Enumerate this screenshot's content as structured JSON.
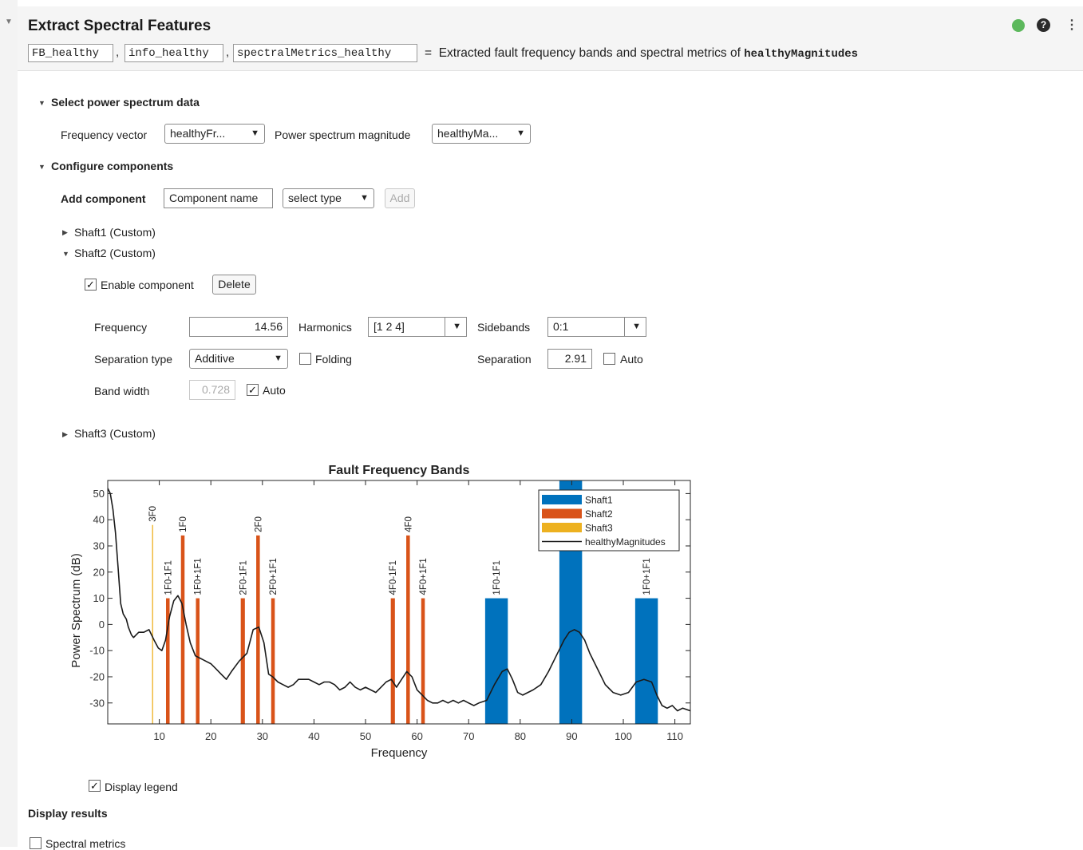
{
  "header": {
    "title": "Extract Spectral Features",
    "outputs": [
      "FB_healthy",
      "info_healthy",
      "spectralMetrics_healthy"
    ],
    "equals": "=",
    "description": "Extracted fault frequency bands and spectral metrics of",
    "description_var": "healthyMagnitudes",
    "status_color": "#5cb85c"
  },
  "power_section": {
    "title": "Select power spectrum data",
    "freq_label": "Frequency vector",
    "freq_value": "healthyFr...",
    "mag_label": "Power spectrum magnitude",
    "mag_value": "healthyMa..."
  },
  "components_section": {
    "title": "Configure components",
    "add_label": "Add component",
    "name_placeholder": "Component name",
    "type_value": "select type",
    "add_button": "Add",
    "shaft1": "Shaft1 (Custom)",
    "shaft2": "Shaft2 (Custom)",
    "shaft3": "Shaft3 (Custom)"
  },
  "shaft2": {
    "enable_label": "Enable component",
    "enabled": true,
    "delete_button": "Delete",
    "frequency_label": "Frequency",
    "frequency_value": "14.56",
    "harmonics_label": "Harmonics",
    "harmonics_value": "[1 2 4]",
    "sidebands_label": "Sidebands",
    "sidebands_value": "0:1",
    "separation_type_label": "Separation type",
    "separation_type_value": "Additive",
    "folding_label": "Folding",
    "folding": false,
    "separation_label": "Separation",
    "separation_value": "2.91",
    "separation_auto_label": "Auto",
    "separation_auto": false,
    "bandwidth_label": "Band width",
    "bandwidth_value": "0.728",
    "bandwidth_auto_label": "Auto",
    "bandwidth_auto": true
  },
  "chart_data": {
    "type": "bar",
    "title": "Fault Frequency Bands",
    "xlabel": "Frequency",
    "ylabel": "Power Spectrum (dB)",
    "xlim": [
      0,
      113
    ],
    "ylim": [
      -38,
      55
    ],
    "xticks": [
      10,
      20,
      30,
      40,
      50,
      60,
      70,
      80,
      90,
      100,
      110
    ],
    "yticks": [
      -30,
      -20,
      -10,
      0,
      10,
      20,
      30,
      40,
      50
    ],
    "grid": false,
    "legend_position": "top-right",
    "series": [
      {
        "name": "Shaft1",
        "color": "#0072BD",
        "bands": [
          {
            "label": "1F0-1F1",
            "x0": 73.2,
            "x1": 77.6,
            "top": 10
          },
          {
            "label": "",
            "x0": 87.6,
            "x1": 92.0,
            "top": 55
          },
          {
            "label": "1F0+1F1",
            "x0": 102.3,
            "x1": 106.7,
            "top": 10
          }
        ]
      },
      {
        "name": "Shaft2",
        "color": "#D95319",
        "bands": [
          {
            "label": "1F0-1F1",
            "x0": 11.3,
            "x1": 12.0,
            "top": 10
          },
          {
            "label": "1F0",
            "x0": 14.2,
            "x1": 14.9,
            "top": 34
          },
          {
            "label": "1F0+1F1",
            "x0": 17.1,
            "x1": 17.8,
            "top": 10
          },
          {
            "label": "2F0-1F1",
            "x0": 25.8,
            "x1": 26.6,
            "top": 10
          },
          {
            "label": "2F0",
            "x0": 28.8,
            "x1": 29.5,
            "top": 34
          },
          {
            "label": "2F0+1F1",
            "x0": 31.7,
            "x1": 32.4,
            "top": 10
          },
          {
            "label": "4F0-1F1",
            "x0": 54.9,
            "x1": 55.7,
            "top": 10
          },
          {
            "label": "4F0",
            "x0": 57.9,
            "x1": 58.6,
            "top": 34
          },
          {
            "label": "4F0+1F1",
            "x0": 60.8,
            "x1": 61.5,
            "top": 10
          }
        ]
      },
      {
        "name": "Shaft3",
        "color": "#EDB120",
        "bands": [
          {
            "label": "3F0",
            "x0": 8.6,
            "x1": 8.8,
            "top": 38
          }
        ]
      },
      {
        "name": "healthyMagnitudes",
        "color": "#1a1a1a",
        "line": [
          [
            0,
            52
          ],
          [
            0.5,
            50
          ],
          [
            1,
            44
          ],
          [
            1.5,
            35
          ],
          [
            2,
            22
          ],
          [
            2.5,
            8
          ],
          [
            3,
            4
          ],
          [
            3.6,
            2
          ],
          [
            4,
            -1
          ],
          [
            4.6,
            -4
          ],
          [
            5,
            -5
          ],
          [
            6,
            -3
          ],
          [
            7,
            -3
          ],
          [
            8,
            -2
          ],
          [
            9,
            -6
          ],
          [
            9.8,
            -9
          ],
          [
            10.5,
            -10
          ],
          [
            11.2,
            -6
          ],
          [
            12,
            3
          ],
          [
            12.8,
            9
          ],
          [
            13.6,
            11
          ],
          [
            14.4,
            8
          ],
          [
            15.2,
            0
          ],
          [
            16,
            -7
          ],
          [
            17,
            -12
          ],
          [
            18,
            -13
          ],
          [
            19,
            -14
          ],
          [
            20,
            -15
          ],
          [
            21,
            -17
          ],
          [
            22,
            -19
          ],
          [
            23,
            -21
          ],
          [
            24,
            -18
          ],
          [
            25.5,
            -14
          ],
          [
            27,
            -11
          ],
          [
            28.2,
            -2
          ],
          [
            29.3,
            -1
          ],
          [
            30.3,
            -7
          ],
          [
            31.2,
            -19
          ],
          [
            32,
            -20
          ],
          [
            33,
            -22
          ],
          [
            34,
            -23
          ],
          [
            35,
            -24
          ],
          [
            36,
            -23
          ],
          [
            37,
            -21
          ],
          [
            38,
            -21
          ],
          [
            39,
            -21
          ],
          [
            40,
            -22
          ],
          [
            41,
            -23
          ],
          [
            42,
            -22
          ],
          [
            43,
            -22
          ],
          [
            44,
            -23
          ],
          [
            45,
            -25
          ],
          [
            46,
            -24
          ],
          [
            47,
            -22
          ],
          [
            48,
            -24
          ],
          [
            49,
            -25
          ],
          [
            50,
            -24
          ],
          [
            51,
            -25
          ],
          [
            52,
            -26
          ],
          [
            53,
            -24
          ],
          [
            54,
            -22
          ],
          [
            55,
            -21
          ],
          [
            56,
            -24
          ],
          [
            57,
            -21
          ],
          [
            58,
            -18
          ],
          [
            59,
            -20
          ],
          [
            60,
            -25
          ],
          [
            61,
            -27
          ],
          [
            62,
            -29
          ],
          [
            63,
            -30
          ],
          [
            64,
            -30
          ],
          [
            65,
            -29
          ],
          [
            66,
            -30
          ],
          [
            67,
            -29
          ],
          [
            68,
            -30
          ],
          [
            69,
            -29
          ],
          [
            70,
            -30
          ],
          [
            71,
            -31
          ],
          [
            72,
            -30
          ],
          [
            73.5,
            -29
          ],
          [
            75,
            -23
          ],
          [
            76.5,
            -18
          ],
          [
            77.5,
            -17
          ],
          [
            78.5,
            -21
          ],
          [
            79.5,
            -26
          ],
          [
            80.5,
            -27
          ],
          [
            81.5,
            -26
          ],
          [
            82.5,
            -25
          ],
          [
            84,
            -23
          ],
          [
            85.5,
            -18
          ],
          [
            87,
            -12
          ],
          [
            88.5,
            -6
          ],
          [
            89.5,
            -3
          ],
          [
            90.5,
            -2
          ],
          [
            91.5,
            -3
          ],
          [
            92.5,
            -6
          ],
          [
            93.5,
            -11
          ],
          [
            95,
            -17
          ],
          [
            96.5,
            -23
          ],
          [
            98,
            -26
          ],
          [
            99.5,
            -27
          ],
          [
            101,
            -26
          ],
          [
            102.5,
            -22
          ],
          [
            104,
            -21
          ],
          [
            105.5,
            -22
          ],
          [
            106.5,
            -27
          ],
          [
            107.5,
            -31
          ],
          [
            108.5,
            -32
          ],
          [
            109.5,
            -31
          ],
          [
            110.5,
            -33
          ],
          [
            111.5,
            -32
          ],
          [
            113,
            -33
          ]
        ]
      }
    ]
  },
  "display_legend_label": "Display legend",
  "display_legend": true,
  "display_results": {
    "title": "Display results",
    "spectral_metrics_label": "Spectral metrics",
    "spectral_metrics": false
  }
}
